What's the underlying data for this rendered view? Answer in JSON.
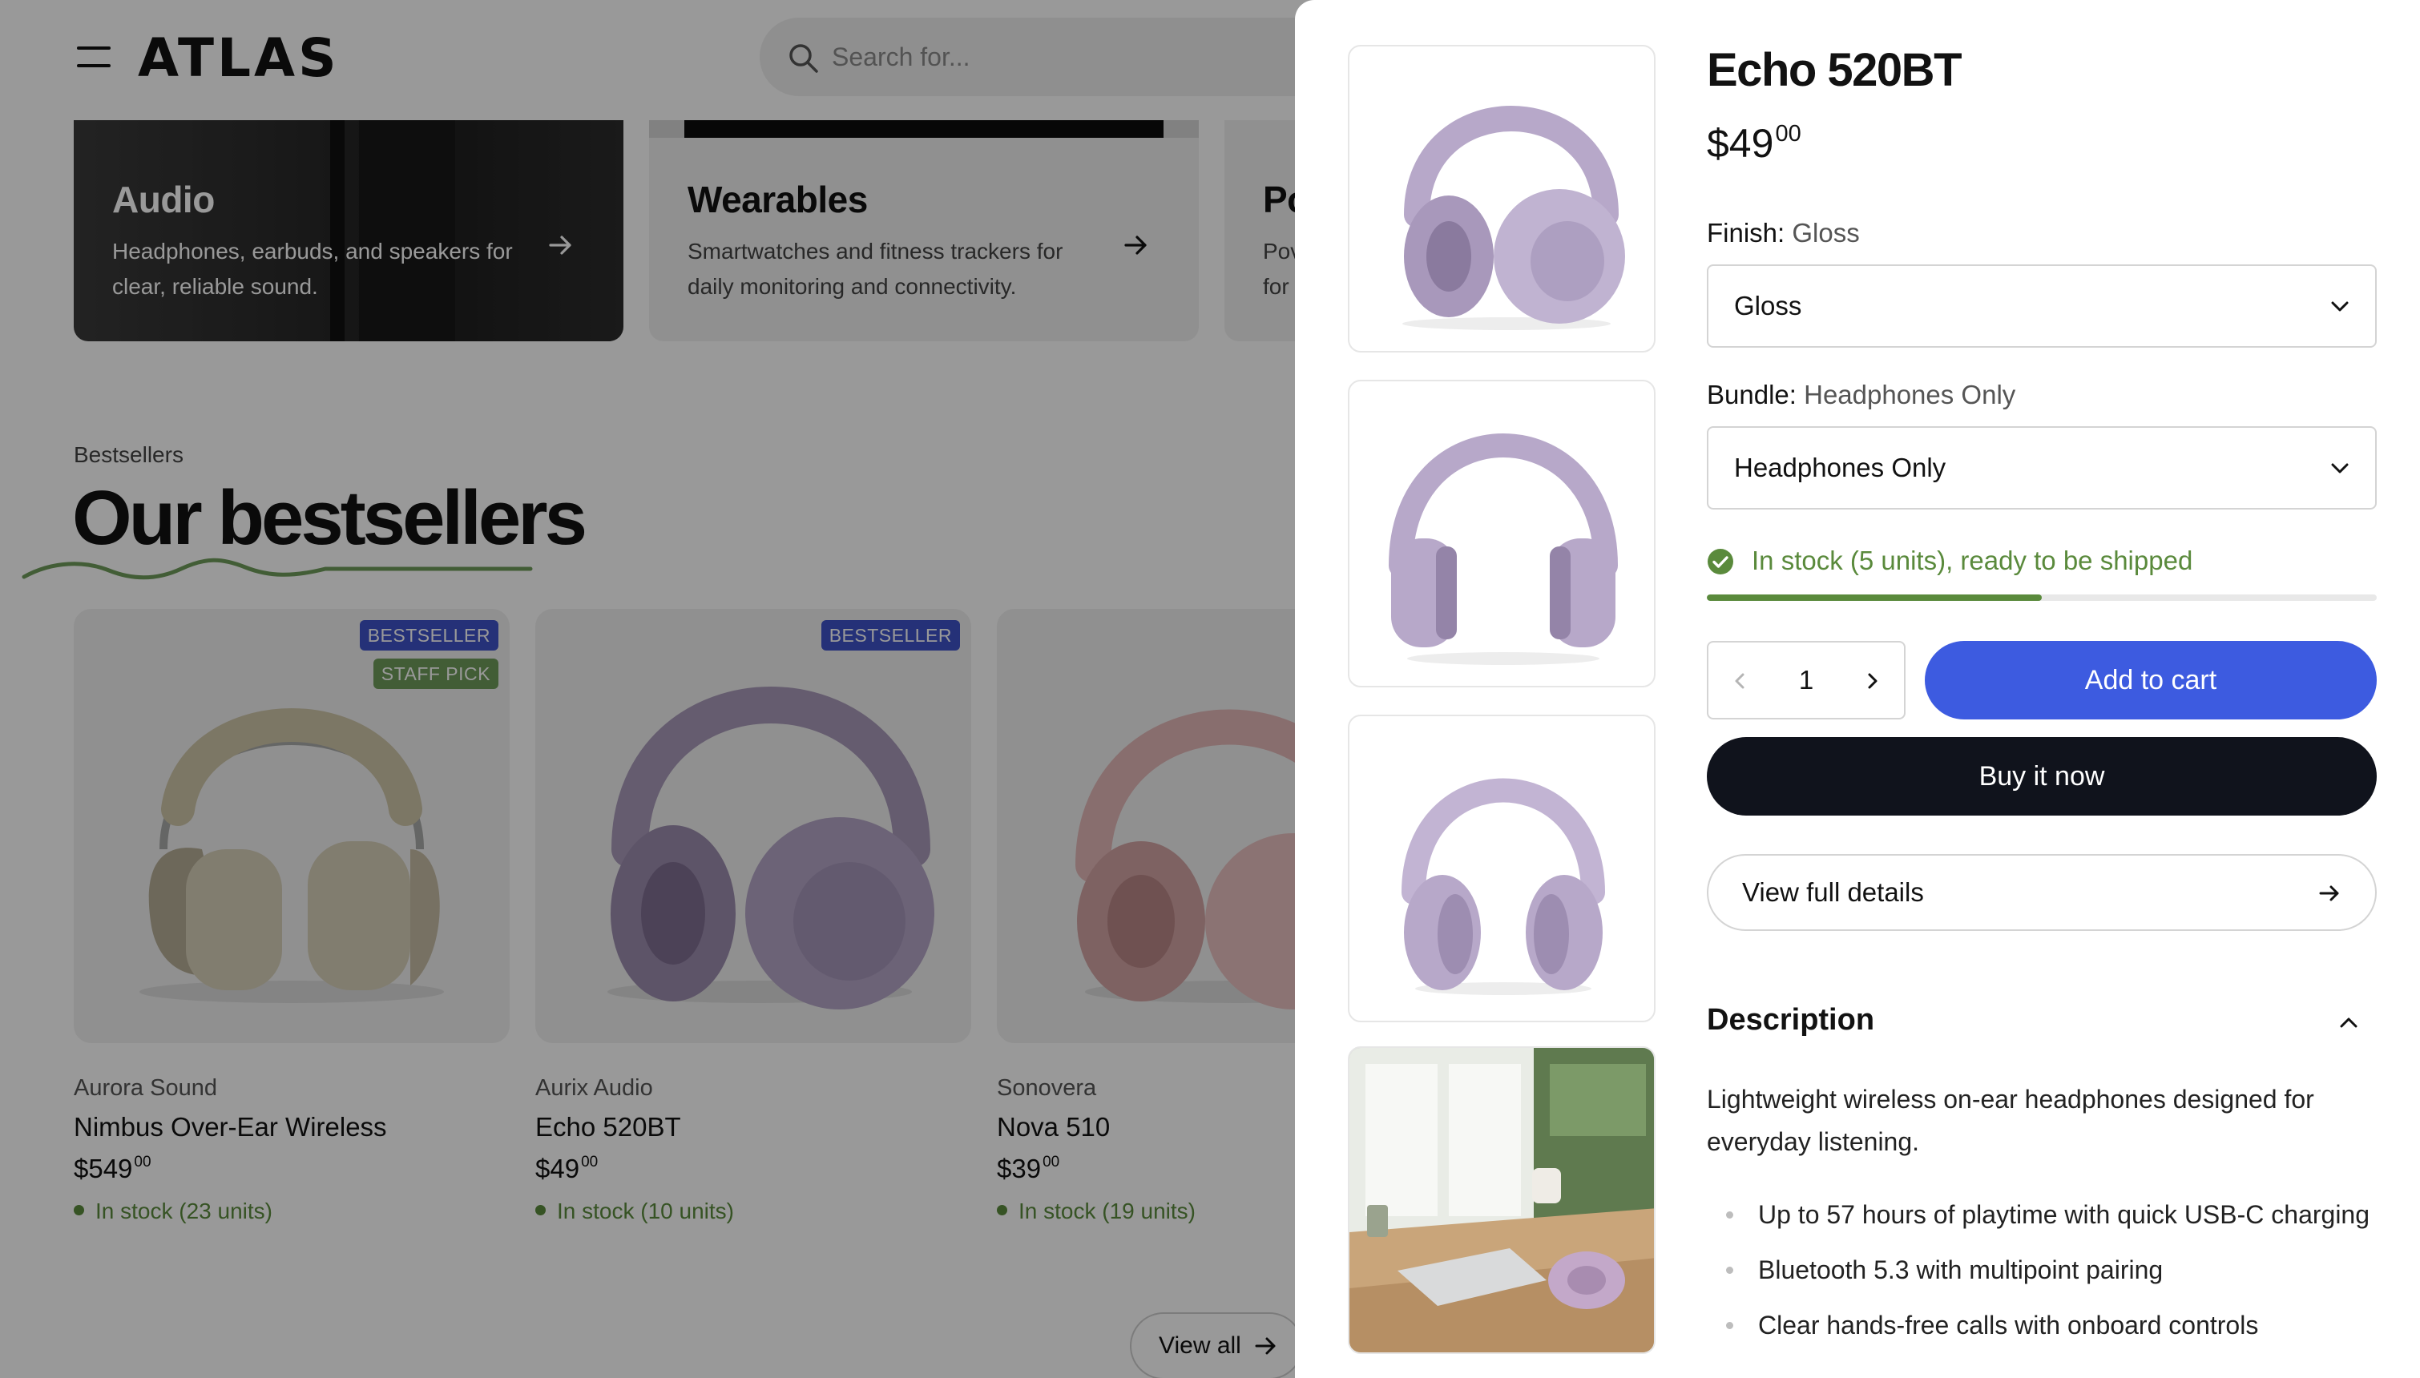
{
  "header": {
    "logo": "ATLAS",
    "search_placeholder": "Search for..."
  },
  "collections": [
    {
      "title": "Audio",
      "description": "Headphones, earbuds, and speakers for clear, reliable sound."
    },
    {
      "title": "Wearables",
      "description": "Smartwatches and fitness trackers for daily monitoring and connectivity."
    },
    {
      "title": "Po",
      "description": "Pov\nfor"
    }
  ],
  "bestsellers": {
    "eyebrow": "Bestsellers",
    "title": "Our bestsellers",
    "view_all": "View all",
    "products": [
      {
        "brand": "Aurora Sound",
        "name": "Nimbus Over-Ear Wireless",
        "price_main": "$549",
        "price_cents": "00",
        "stock": "In stock (23 units)",
        "badges": [
          "BESTSELLER",
          "STAFF PICK"
        ],
        "colors": {
          "band": "#cfc6a9",
          "cup": "#d8d0ba",
          "pad": "#bfb6a0",
          "metal": "#a9aaa9"
        }
      },
      {
        "brand": "Aurix Audio",
        "name": "Echo 520BT",
        "price_main": "$49",
        "price_cents": "00",
        "stock": "In stock (10 units)",
        "badges": [
          "BESTSELLER"
        ],
        "colors": {
          "band": "#a99ab9",
          "cup": "#b4a6c6",
          "pad": "#9c8cae",
          "metal": "#a99ab9"
        }
      },
      {
        "brand": "Sonovera",
        "name": "Nova 510",
        "price_main": "$39",
        "price_cents": "00",
        "stock": "In stock (19 units)",
        "badges": [],
        "colors": {
          "band": "#e3b8b8",
          "cup": "#e8c0c0",
          "pad": "#d2a3a3",
          "metal": "#e3b8b8"
        }
      }
    ]
  },
  "drawer": {
    "title": "Echo 520BT",
    "price_main": "$49",
    "price_cents": "00",
    "finish_label": "Finish:",
    "finish_value": "Gloss",
    "finish_selected": "Gloss",
    "bundle_label": "Bundle:",
    "bundle_value": "Headphones Only",
    "bundle_selected": "Headphones Only",
    "stock_text": "In stock (5 units), ready to be shipped",
    "stock_level": 0.5,
    "quantity": "1",
    "add_to_cart": "Add to cart",
    "buy_now": "Buy it now",
    "view_details": "View full details",
    "description_heading": "Description",
    "description_text": "Lightweight wireless on-ear headphones designed for everyday listening.",
    "features": [
      "Up to 57 hours of playtime with quick USB-C charging",
      "Bluetooth 5.3 with multipoint pairing",
      "Clear hands-free calls with onboard controls"
    ]
  },
  "icons": {
    "menu": "menu-icon",
    "search": "search-icon",
    "arrow": "arrow-right-icon",
    "chevron_down": "chevron-down-icon",
    "chevron_up": "chevron-up-icon",
    "check": "check-circle-icon"
  },
  "colors": {
    "accent_blue": "#3d5be0",
    "stock_green": "#5a8a3c",
    "badge_bestseller": "#3f52c8",
    "badge_staff_pick": "#6f9c5a",
    "buy_now_bg": "#10131c",
    "overlay": "rgba(0,0,0,0.40)"
  }
}
